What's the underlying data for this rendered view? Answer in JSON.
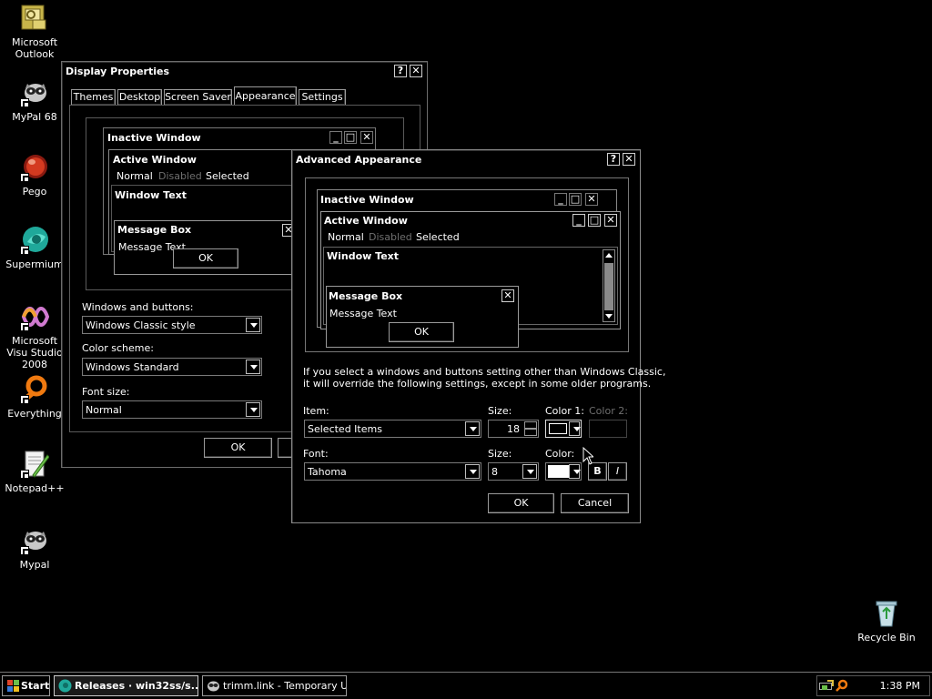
{
  "desktop": {
    "icons": [
      {
        "label": "Microsoft Outlook",
        "icon": "outlook-icon"
      },
      {
        "label": "MyPal 68",
        "icon": "raccoon-icon"
      },
      {
        "label": "Pego",
        "icon": "red-ball-icon"
      },
      {
        "label": "Supermium",
        "icon": "supermium-icon"
      },
      {
        "label": "Microsoft Visu Studio 2008",
        "icon": "visual-studio-icon"
      },
      {
        "label": "Everything",
        "icon": "search-ring-icon"
      },
      {
        "label": "Notepad++",
        "icon": "notepad-plus-icon"
      },
      {
        "label": "Mypal",
        "icon": "raccoon-icon"
      },
      {
        "label": "Recycle Bin",
        "icon": "recycle-bin-icon"
      }
    ]
  },
  "display": {
    "title": "Display Properties",
    "help": "?",
    "close": "✕",
    "tabs": [
      "Themes",
      "Desktop",
      "Screen Saver",
      "Appearance",
      "Settings"
    ],
    "active_tab": "Appearance",
    "preview": {
      "inactive": "Inactive Window",
      "active": "Active Window",
      "menu": [
        "Normal",
        "Disabled",
        "Selected"
      ],
      "window_text": "Window Text",
      "msgbox": "Message Box",
      "msg_text": "Message Text",
      "ok": "OK"
    },
    "windows_buttons_label": "Windows and buttons:",
    "windows_buttons_value": "Windows Classic style",
    "color_scheme_label": "Color scheme:",
    "color_scheme_value": "Windows Standard",
    "font_size_label": "Font size:",
    "font_size_value": "Normal",
    "ok": "OK"
  },
  "advanced": {
    "title": "Advanced Appearance",
    "help": "?",
    "close": "✕",
    "preview": {
      "inactive": "Inactive Window",
      "active": "Active Window",
      "menu": [
        "Normal",
        "Disabled",
        "Selected"
      ],
      "window_text": "Window Text",
      "msgbox": "Message Box",
      "msg_text": "Message Text",
      "ok": "OK"
    },
    "note_line1": "If you select a windows and buttons setting other than Windows Classic,",
    "note_line2": "it will override the following settings, except in some older programs.",
    "item_label": "Item:",
    "item_value": "Selected Items",
    "size_label": "Size:",
    "size_value": "18",
    "color1_label": "Color 1:",
    "color2_label": "Color 2:",
    "font_label": "Font:",
    "font_value": "Tahoma",
    "font_size_label": "Size:",
    "font_size_value": "8",
    "color_label": "Color:",
    "bold": "B",
    "italic": "I",
    "ok": "OK",
    "cancel": "Cancel"
  },
  "taskbar": {
    "start": "Start",
    "tasks": [
      "Releases · win32ss/s...",
      "trimm.link - Temporary U..."
    ],
    "clock": "1:38 PM"
  }
}
